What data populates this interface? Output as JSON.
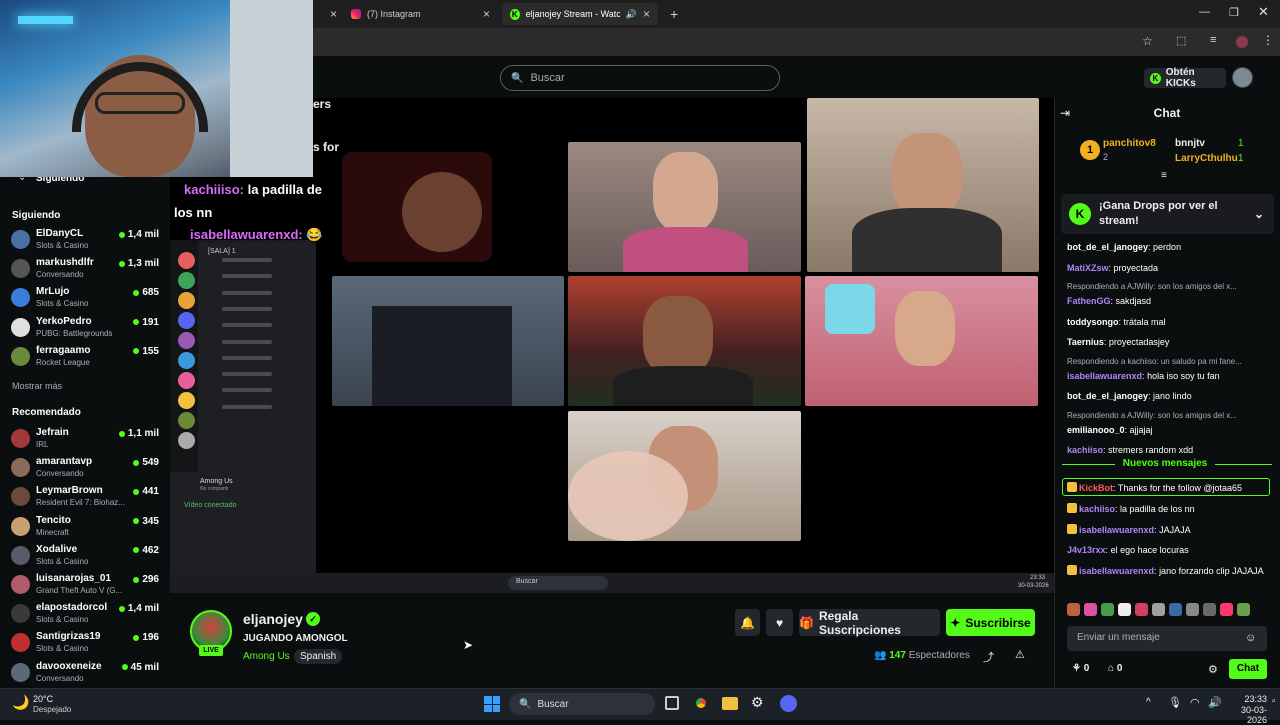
{
  "browser": {
    "tabs": [
      {
        "label": "(7) Instagram"
      },
      {
        "label": "eljanojey Stream - Watch L"
      }
    ]
  },
  "header": {
    "search_placeholder": "Buscar",
    "get_kicks": "Obtén KICKs"
  },
  "sidebar": {
    "following_header": "Siguiendo",
    "following_title": "Siguiendo",
    "following": [
      {
        "name": "ElDanyCL",
        "category": "Slots & Casino",
        "viewers": "1,4 mil",
        "color": "#4a6fa5"
      },
      {
        "name": "markushdlfr",
        "category": "Conversando",
        "viewers": "1,3 mil",
        "color": "#555"
      },
      {
        "name": "MrLujo",
        "category": "Slots & Casino",
        "viewers": "685",
        "color": "#3b7dd8"
      },
      {
        "name": "YerkoPedro",
        "category": "PUBG: Battlegrounds",
        "viewers": "191",
        "color": "#e0e0e0"
      },
      {
        "name": "ferragaamo",
        "category": "Rocket League",
        "viewers": "155",
        "color": "#6a8a3a"
      }
    ],
    "show_more": "Mostrar más",
    "recommended_title": "Recomendado",
    "recommended": [
      {
        "name": "Jefrain",
        "category": "IRL",
        "viewers": "1,1 mil",
        "color": "#a03a3a"
      },
      {
        "name": "amarantavp",
        "category": "Conversando",
        "viewers": "549",
        "color": "#8a6a5a"
      },
      {
        "name": "LeymarBrown",
        "category": "Resident Evil 7: Biohaz...",
        "viewers": "441",
        "color": "#6a4a3a"
      },
      {
        "name": "Tencito",
        "category": "Minecraft",
        "viewers": "345",
        "color": "#c9a070"
      },
      {
        "name": "Xodalive",
        "category": "Slots & Casino",
        "viewers": "462",
        "color": "#5a5a6a"
      },
      {
        "name": "luisanarojas_01",
        "category": "Grand Theft Auto V (G...",
        "viewers": "296",
        "color": "#b05a6a"
      },
      {
        "name": "elapostadorcol",
        "category": "Slots & Casino",
        "viewers": "1,4 mil",
        "color": "#3a3a3a"
      },
      {
        "name": "Santigrizas19",
        "category": "Slots & Casino",
        "viewers": "196",
        "color": "#c03030"
      },
      {
        "name": "davooxeneize",
        "category": "Conversando",
        "viewers": "45 mil",
        "color": "#5a6a7a"
      }
    ]
  },
  "video": {
    "overlay_title": "ers",
    "overlay_title2": "s for",
    "overlay_chat": [
      {
        "user": "kachiiiso:",
        "text": " la padilla de"
      },
      {
        "user": "",
        "text": "los nn"
      },
      {
        "user": "isabellawuarenxd:",
        "text": " 😂"
      }
    ],
    "discord_channel": "[SALA] 1",
    "discord_voice": "Among Us",
    "discord_voice_sub": "No compartir",
    "discord_connected": "Vídeo conectado",
    "inner_search": "Buscar",
    "inner_time": "23:33",
    "inner_date": "30-03-2026"
  },
  "stream": {
    "streamer": "eljanojey",
    "live": "LIVE",
    "title": "JUGANDO AMONGOL",
    "category": "Among Us",
    "language": "Spanish",
    "gift_subs": "Regala Suscripciones",
    "subscribe": "Suscribirse",
    "viewers_count": "147",
    "viewers_label": "Espectadores"
  },
  "chat": {
    "title": "Chat",
    "top_gifters": [
      {
        "name": "panchitov8",
        "count": "2"
      },
      {
        "name": "bnnjtv",
        "count": "1"
      },
      {
        "name": "LarryCthulhu",
        "count": "1"
      }
    ],
    "drops_banner": "¡Gana Drops por ver el stream!",
    "messages": [
      {
        "reply": "",
        "user": "bot_de_el_janogey",
        "color": "#ffffff",
        "text": "perdon"
      },
      {
        "reply": "",
        "user": "MatiXZsw",
        "color": "#b084f7",
        "text": "proyectada"
      },
      {
        "reply": "Respondiendo a AJWilly: son los amigos del x...",
        "user": "FathenGG",
        "color": "#b084f7",
        "text": "sakdjasd"
      },
      {
        "reply": "",
        "user": "toddysongo",
        "color": "#ffffff",
        "text": "trátala mal"
      },
      {
        "reply": "",
        "user": "Taernius",
        "color": "#ffffff",
        "text": "proyectadasjey"
      },
      {
        "reply": "Respondiendo a kachiiso: un saludo pa mi fane...",
        "user": "isabellawuarenxd",
        "color": "#b084f7",
        "text": "hola iso soy tu fan"
      },
      {
        "reply": "",
        "user": "bot_de_el_janogey",
        "color": "#ffffff",
        "text": "jano lindo"
      },
      {
        "reply": "Respondiendo a AJWilly: son los amigos del x...",
        "user": "emilianooo_0",
        "color": "#ffffff",
        "text": "ajjajaj"
      },
      {
        "reply": "",
        "user": "kachiiso",
        "color": "#b084f7",
        "text": "stremers random xdd"
      }
    ],
    "new_messages": "Nuevos mensajes",
    "new": [
      {
        "user": "KickBot",
        "color": "#ff5a5a",
        "text": "Thanks for the follow @jotaa65"
      },
      {
        "user": "kachiiso",
        "color": "#b084f7",
        "text": "la padilla de los nn"
      },
      {
        "user": "isabellawuarenxd",
        "color": "#b084f7",
        "text": "JAJAJA"
      },
      {
        "user": "J4v13rxx",
        "color": "#b084f7",
        "text": "el ego hace locuras"
      },
      {
        "user": "isabellawuarenxd",
        "color": "#b084f7",
        "text": "jano forzando clip JAJAJA"
      }
    ],
    "input_placeholder": "Enviar un mensaje",
    "points": "0",
    "store": "0",
    "send": "Chat"
  },
  "taskbar": {
    "weather_temp": "20°C",
    "weather_desc": "Despejado",
    "search": "Buscar",
    "time": "23:33",
    "date": "30-03-2026"
  }
}
